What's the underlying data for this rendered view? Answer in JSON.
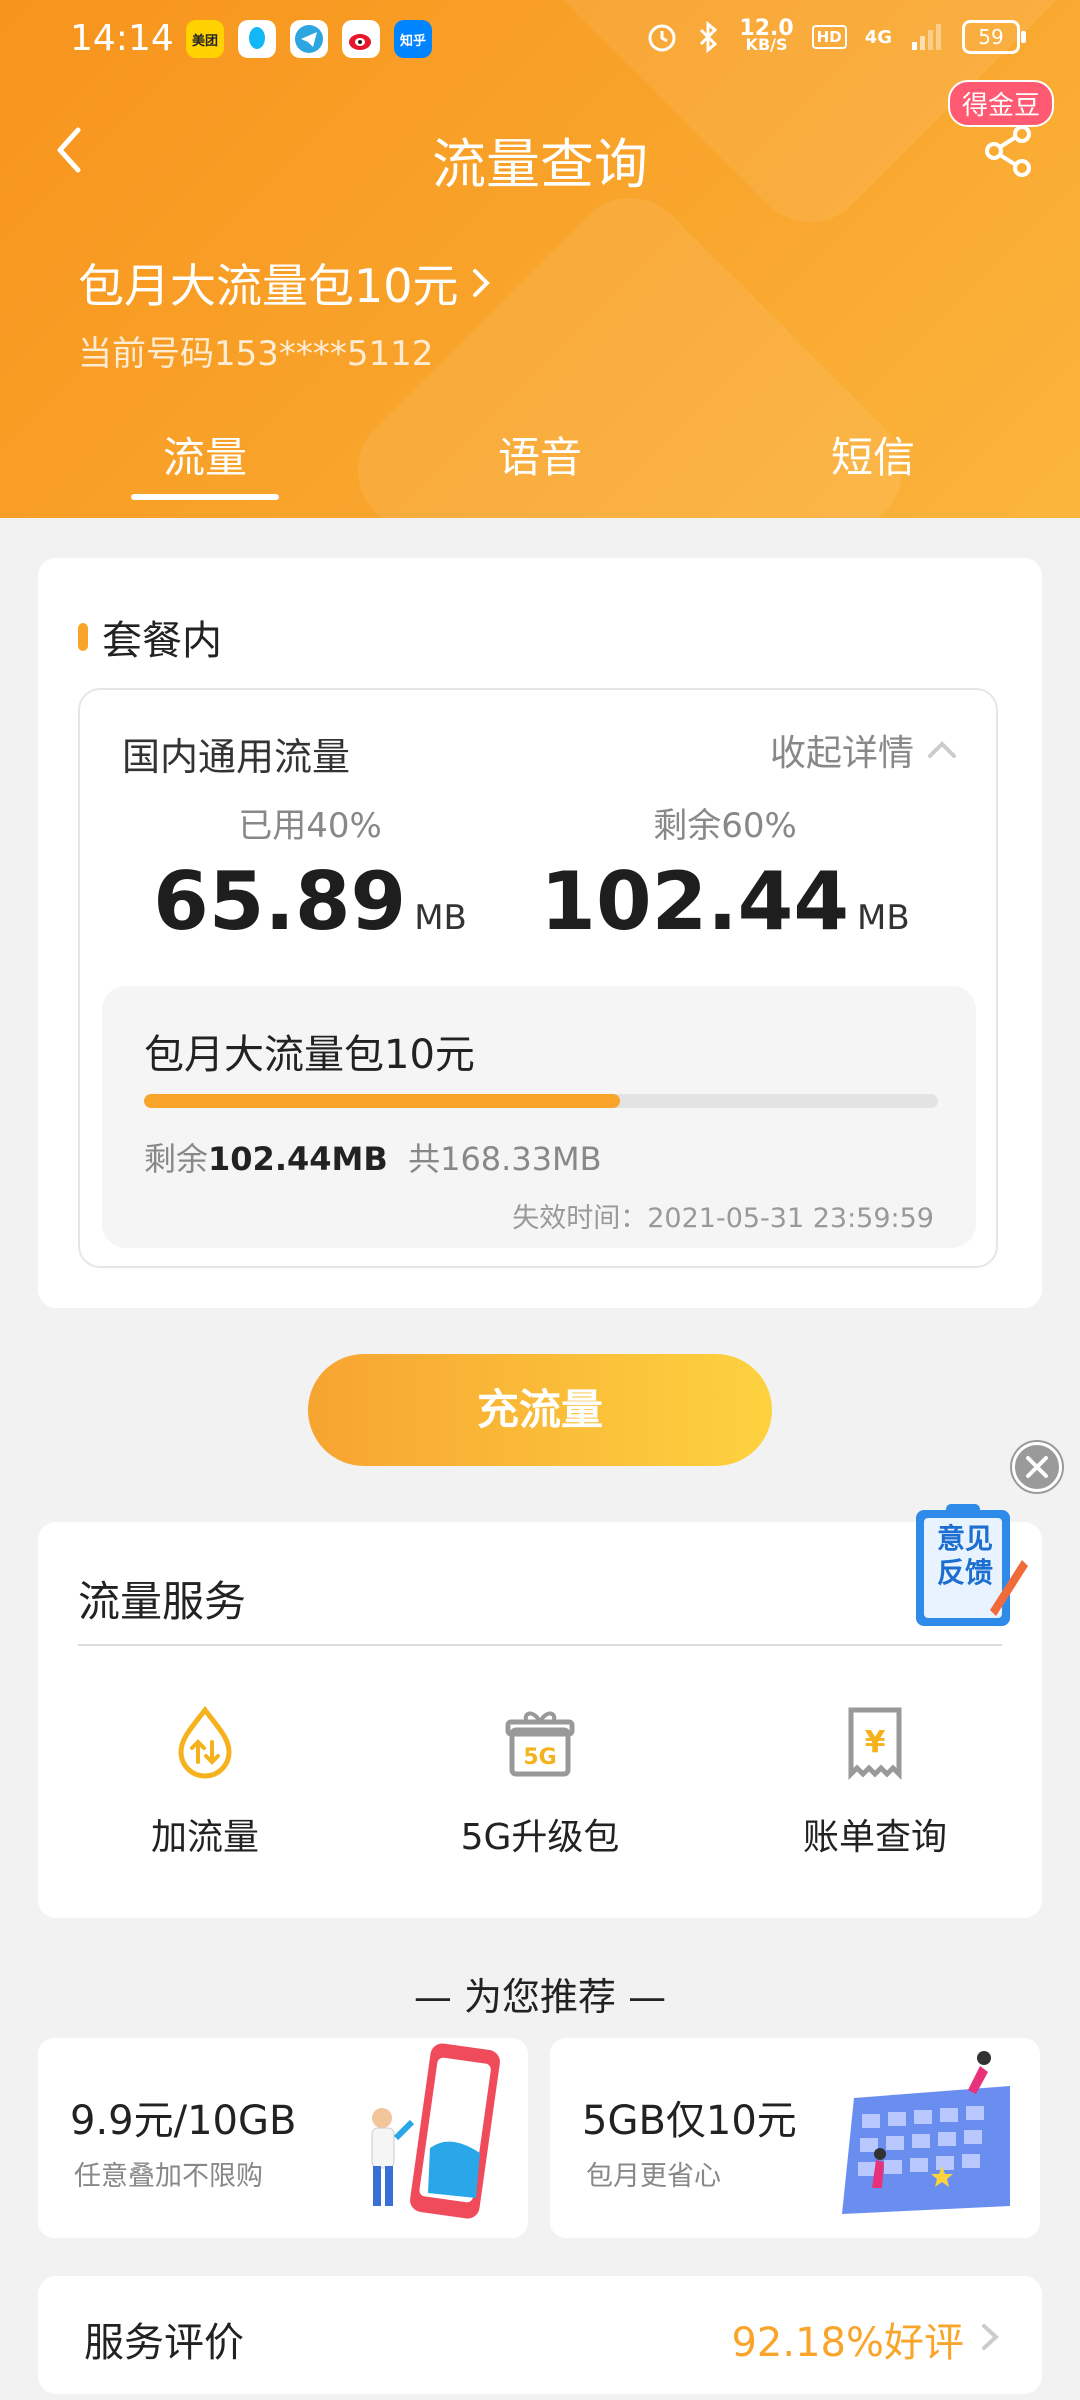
{
  "status_bar": {
    "time": "14:14",
    "apps": [
      "美团",
      "QQ",
      "Telegram",
      "微博",
      "知乎"
    ],
    "netspeed_value": "12.0",
    "netspeed_unit": "KB/S",
    "hd": "HD",
    "network": "4G",
    "battery": "59"
  },
  "header": {
    "title": "流量查询",
    "gold_badge": "得金豆",
    "plan_name": "包月大流量包10元",
    "phone_line": "当前号码153****5112",
    "tabs": [
      {
        "label": "流量",
        "active": true
      },
      {
        "label": "语音",
        "active": false
      },
      {
        "label": "短信",
        "active": false
      }
    ]
  },
  "package": {
    "section_title": "套餐内",
    "domestic_label": "国内通用流量",
    "collapse_label": "收起详情",
    "used_label": "已用40%",
    "used_value": "65.89",
    "used_unit": "MB",
    "remain_label": "剩余60%",
    "remain_value": "102.44",
    "remain_unit": "MB",
    "detail": {
      "name": "包月大流量包10元",
      "progress_fraction": 0.6,
      "remain_prefix": "剩余",
      "remain_amount": "102.44MB",
      "total": "共168.33MB",
      "expire": "失效时间：2021-05-31 23:59:59"
    }
  },
  "recharge_label": "充流量",
  "feedback": {
    "line1": "意见",
    "line2": "反馈"
  },
  "services": {
    "title": "流量服务",
    "items": [
      {
        "label": "加流量",
        "icon": "add-data-icon"
      },
      {
        "label": "5G升级包",
        "icon": "gift-5g-icon"
      },
      {
        "label": "账单查询",
        "icon": "bill-icon"
      }
    ]
  },
  "recommend": {
    "heading": "— 为您推荐 —",
    "cards": [
      {
        "title": "9.9元/10GB",
        "subtitle": "任意叠加不限购"
      },
      {
        "title": "5GB仅10元",
        "subtitle": "包月更省心"
      }
    ]
  },
  "rating": {
    "label": "服务评价",
    "value": "92.18%好评"
  },
  "colors": {
    "accent": "#f9a52c",
    "header_start": "#f7941d",
    "header_end": "#fbb53d",
    "badge": "#ff5a72"
  }
}
